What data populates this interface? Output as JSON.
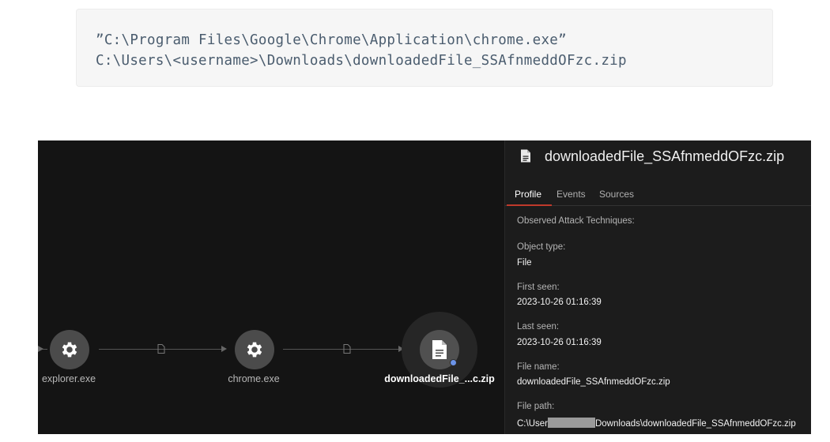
{
  "code_block": {
    "line1": "”C:\\Program Files\\Google\\Chrome\\Application\\chrome.exe”",
    "line2": "C:\\Users\\<username>\\Downloads\\downloadedFile_SSAfnmeddOFzc.zip"
  },
  "graph": {
    "nodes": [
      {
        "label": "explorer.exe",
        "icon": "gear-icon"
      },
      {
        "label": "chrome.exe",
        "icon": "gear-icon"
      },
      {
        "label": "downloadedFile_...c.zip",
        "icon": "file-icon",
        "selected": true
      }
    ],
    "edge_icon": "file-icon",
    "accent_dot_color": "#6b93e8"
  },
  "panel": {
    "title": "downloadedFile_SSAfnmeddOFzc.zip",
    "title_icon": "file-icon",
    "tabs": [
      "Profile",
      "Events",
      "Sources"
    ],
    "active_tab": "Profile",
    "fields": {
      "attack_techniques_label": "Observed Attack Techniques:",
      "object_type_label": "Object type:",
      "object_type_value": "File",
      "first_seen_label": "First seen:",
      "first_seen_value": "2023-10-26 01:16:39",
      "last_seen_label": "Last seen:",
      "last_seen_value": "2023-10-26 01:16:39",
      "file_name_label": "File name:",
      "file_name_value": "downloadedFile_SSAfnmeddOFzc.zip",
      "file_path_label": "File path:",
      "file_path_prefix": "C:\\User",
      "file_path_suffix": "Downloads\\downloadedFile_SSAfnmeddOFzc.zip"
    },
    "accent_color": "#c0392b"
  }
}
